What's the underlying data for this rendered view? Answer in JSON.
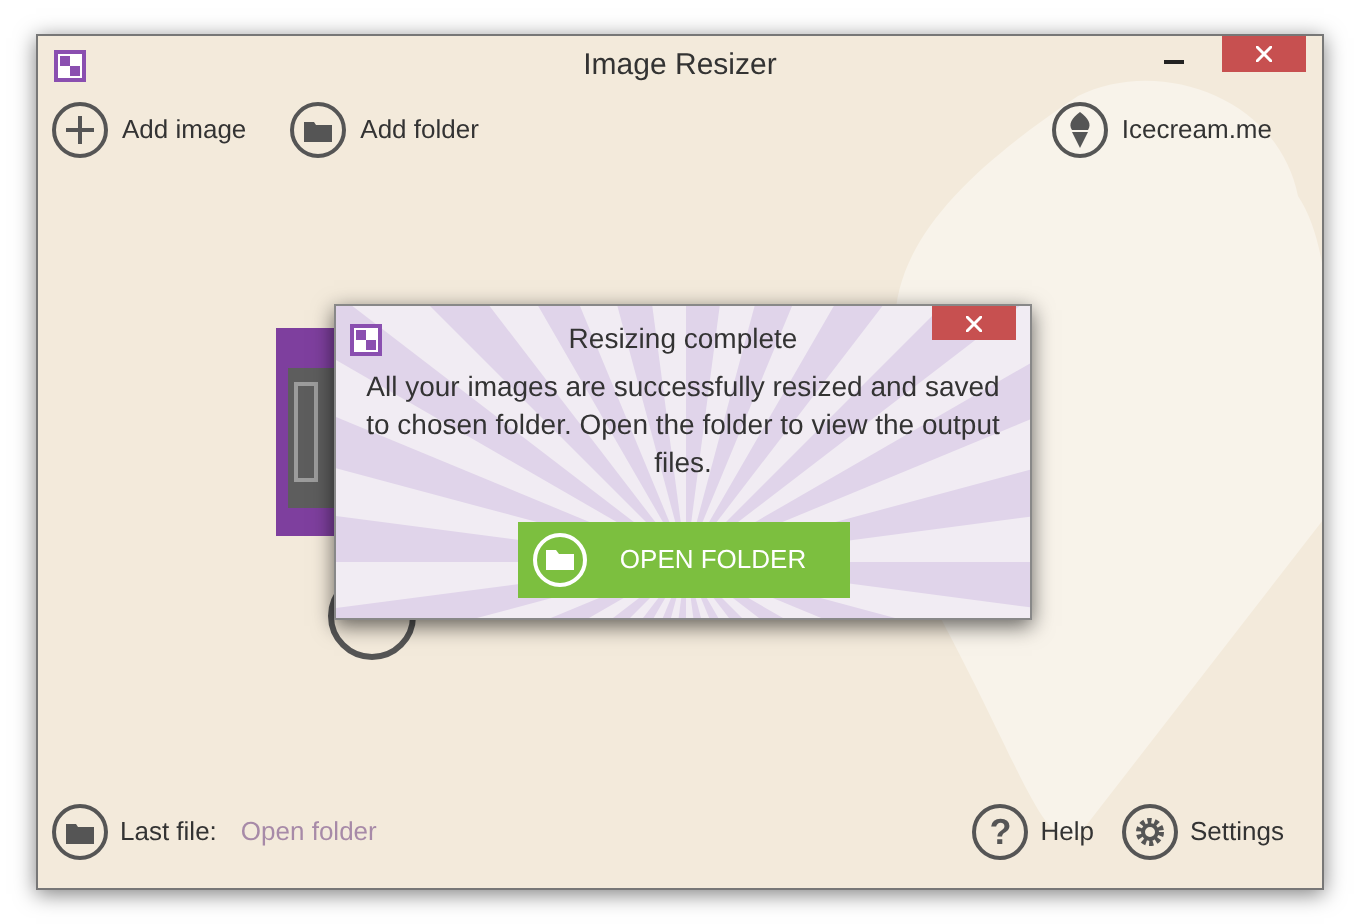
{
  "window": {
    "title": "Image Resizer"
  },
  "toolbar": [
    {
      "kind": "add",
      "label": "Add image"
    },
    {
      "kind": "folder",
      "label": "Add folder"
    }
  ],
  "site_link": {
    "label": "Icecream.me"
  },
  "dialog": {
    "title": "Resizing complete",
    "message": "All your images are successfully resized and saved to chosen folder. Open the folder to view the output files.",
    "button": "OPEN FOLDER"
  },
  "footer": {
    "last_file_label": "Last file:",
    "last_file_link": "Open folder",
    "buttons": [
      {
        "kind": "help",
        "icon": "?",
        "label": "Help"
      },
      {
        "kind": "settings",
        "label": "Settings"
      }
    ]
  }
}
